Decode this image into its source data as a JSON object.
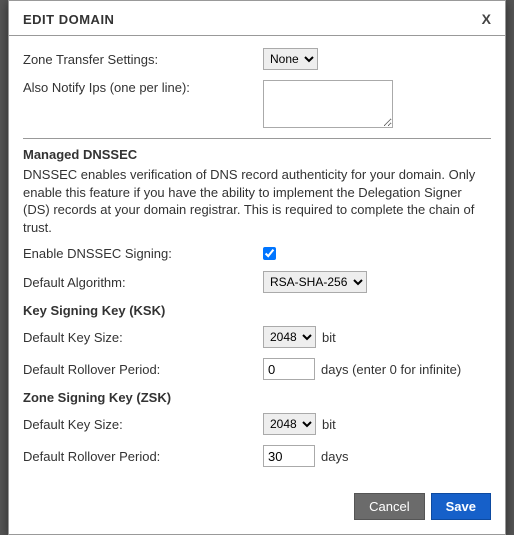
{
  "modal": {
    "title": "EDIT DOMAIN",
    "close": "X"
  },
  "zone": {
    "transfer_label": "Zone Transfer Settings:",
    "transfer_value": "None",
    "notify_label": "Also Notify Ips (one per line):",
    "notify_value": ""
  },
  "dnssec": {
    "heading": "Managed DNSSEC",
    "description": "DNSSEC enables verification of DNS record authenticity for your domain. Only enable this feature if you have the ability to implement the Delegation Signer (DS) records at your domain registrar. This is required to complete the chain of trust.",
    "enable_label": "Enable DNSSEC Signing:",
    "enable_checked": true,
    "algo_label": "Default Algorithm:",
    "algo_value": "RSA-SHA-256",
    "ksk": {
      "heading": "Key Signing Key (KSK)",
      "keysize_label": "Default Key Size:",
      "keysize_value": "2048",
      "keysize_suffix": "bit",
      "rollover_label": "Default Rollover Period:",
      "rollover_value": "0",
      "rollover_suffix": "days (enter 0 for infinite)"
    },
    "zsk": {
      "heading": "Zone Signing Key (ZSK)",
      "keysize_label": "Default Key Size:",
      "keysize_value": "2048",
      "keysize_suffix": "bit",
      "rollover_label": "Default Rollover Period:",
      "rollover_value": "30",
      "rollover_suffix": "days"
    }
  },
  "footer": {
    "cancel": "Cancel",
    "save": "Save"
  }
}
